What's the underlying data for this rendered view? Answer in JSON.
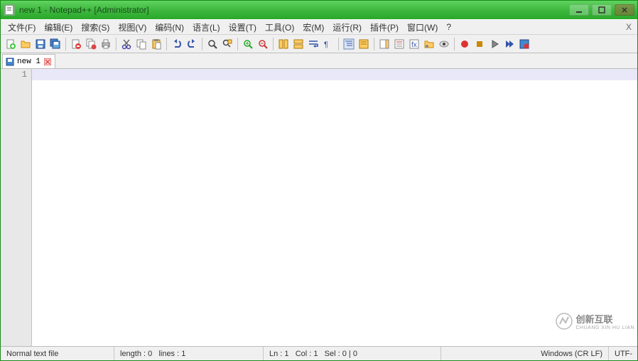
{
  "title": "new 1 - Notepad++ [Administrator]",
  "menu": {
    "file": "文件(F)",
    "edit": "编辑(E)",
    "search": "搜索(S)",
    "view": "视图(V)",
    "encoding": "编码(N)",
    "language": "语言(L)",
    "settings": "设置(T)",
    "tools": "工具(O)",
    "macro": "宏(M)",
    "run": "运行(R)",
    "plugins": "插件(P)",
    "window": "窗口(W)",
    "help": "?"
  },
  "tab": {
    "label": "new 1"
  },
  "gutter": {
    "line1": "1"
  },
  "status": {
    "filetype": "Normal text file",
    "length": "length : 0",
    "lines": "lines : 1",
    "ln": "Ln : 1",
    "col": "Col : 1",
    "sel": "Sel : 0 | 0",
    "eol": "Windows (CR LF)",
    "enc": "UTF-"
  },
  "watermark": {
    "main": "创新互联",
    "sub": "CHUANG XIN HU LIAN"
  }
}
